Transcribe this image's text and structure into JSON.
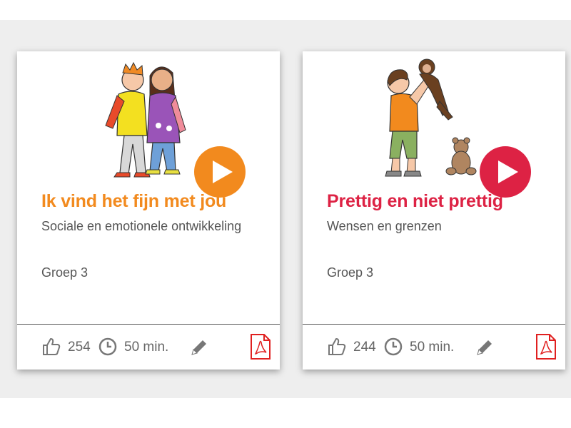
{
  "cards": [
    {
      "title": "Ik vind het fijn met jou",
      "subtitle": "Sociale en emotionele ontwikkeling",
      "group": "Groep 3",
      "likes": "254",
      "duration": "50 min.",
      "accent": "#f28a1e",
      "illustration": "kissing-children",
      "icons": [
        "play-icon",
        "thumbs-up-icon",
        "clock-icon",
        "pencil-icon",
        "pdf-icon"
      ]
    },
    {
      "title": "Prettig en niet prettig",
      "subtitle": "Wensen en grenzen",
      "group": "Groep 3",
      "likes": "244",
      "duration": "50 min.",
      "accent": "#dd2244",
      "illustration": "child-holding-monkey-with-teddy-bear",
      "icons": [
        "play-icon",
        "thumbs-up-icon",
        "clock-icon",
        "pencil-icon",
        "pdf-icon"
      ]
    }
  ],
  "colors": {
    "page_band": "#eeeeee",
    "card_background": "#ffffff",
    "text_muted": "#555555",
    "icon_grey": "#777777",
    "pdf_red": "#e02020"
  }
}
